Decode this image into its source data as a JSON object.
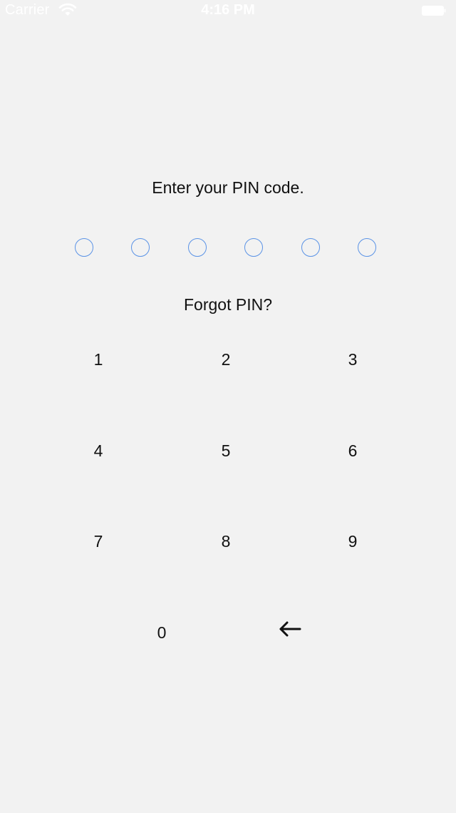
{
  "status_bar": {
    "carrier": "Carrier",
    "time": "4:16 PM",
    "icons": [
      "wifi-icon",
      "battery-icon"
    ]
  },
  "prompt": "Enter your PIN code.",
  "pin": {
    "length": 6,
    "filled": 0,
    "dot_color": "#5b93e6"
  },
  "forgot_link": "Forgot PIN?",
  "keypad": {
    "k1": "1",
    "k2": "2",
    "k3": "3",
    "k4": "4",
    "k5": "5",
    "k6": "6",
    "k7": "7",
    "k8": "8",
    "k9": "9",
    "k0": "0",
    "backspace_icon": "back-arrow-icon"
  },
  "colors": {
    "background": "#f2f2f2",
    "text": "#111111",
    "status_text": "#ffffff"
  }
}
